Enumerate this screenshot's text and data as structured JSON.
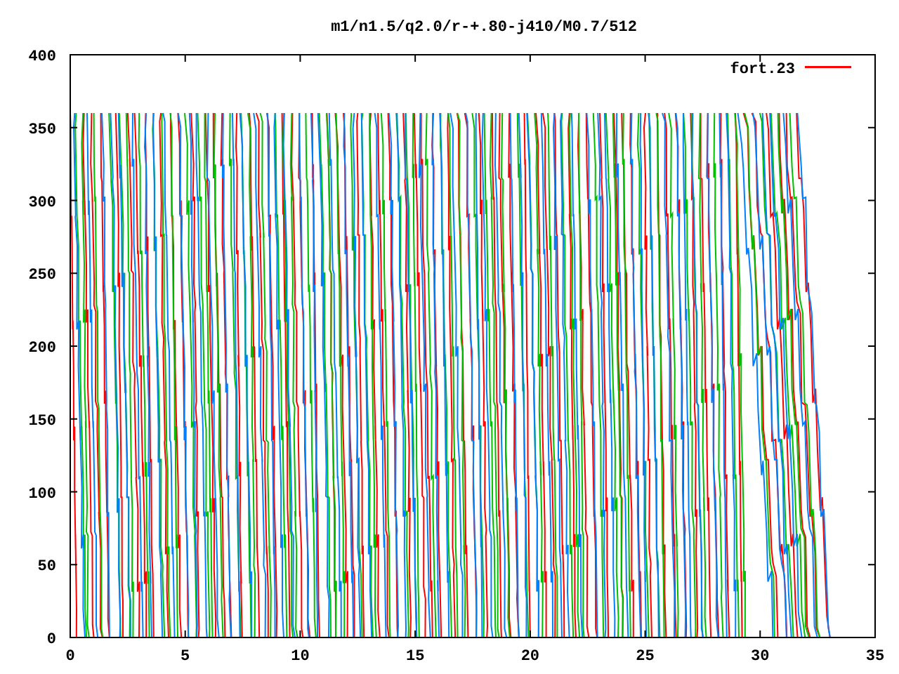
{
  "plot": {
    "title": "m1/n1.5/q2.0/r-+.80-j410/M0.7/512",
    "x_tick_labels": [
      "0",
      "5",
      "10",
      "15",
      "20",
      "25",
      "30",
      "35"
    ],
    "y_tick_labels": [
      "400",
      "350",
      "300",
      "250",
      "200",
      "150",
      "100",
      "50",
      "0"
    ],
    "legend": [
      {
        "label": "fort.23",
        "color": "#ff0000"
      }
    ]
  }
}
